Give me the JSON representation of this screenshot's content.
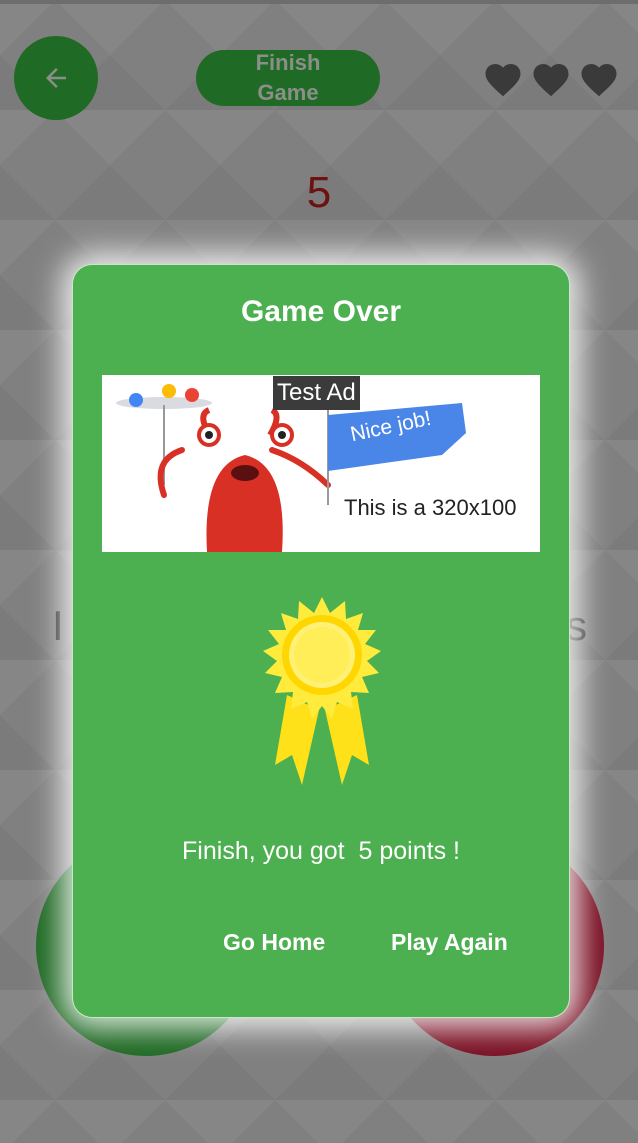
{
  "header": {
    "finish_label": "Finish\nGame",
    "lives": 3
  },
  "score": "5",
  "background": {
    "partial_left_text": "I",
    "partial_right_text": "s"
  },
  "dialog": {
    "title": "Game Over",
    "ad": {
      "label": "Test Ad",
      "flag_text": "Nice job!",
      "banner_text": "This is a 320x100"
    },
    "message": "Finish, you got  5 points !",
    "go_home_label": "Go Home",
    "play_again_label": "Play Again"
  },
  "colors": {
    "dialog": "#4caf50",
    "dark_green": "#1f6a24",
    "dark_red": "#7a1024",
    "score": "#6e1111",
    "medal": "#ffeb3b"
  },
  "icons": [
    "arrow-back-icon",
    "heart-icon",
    "medal-icon"
  ]
}
